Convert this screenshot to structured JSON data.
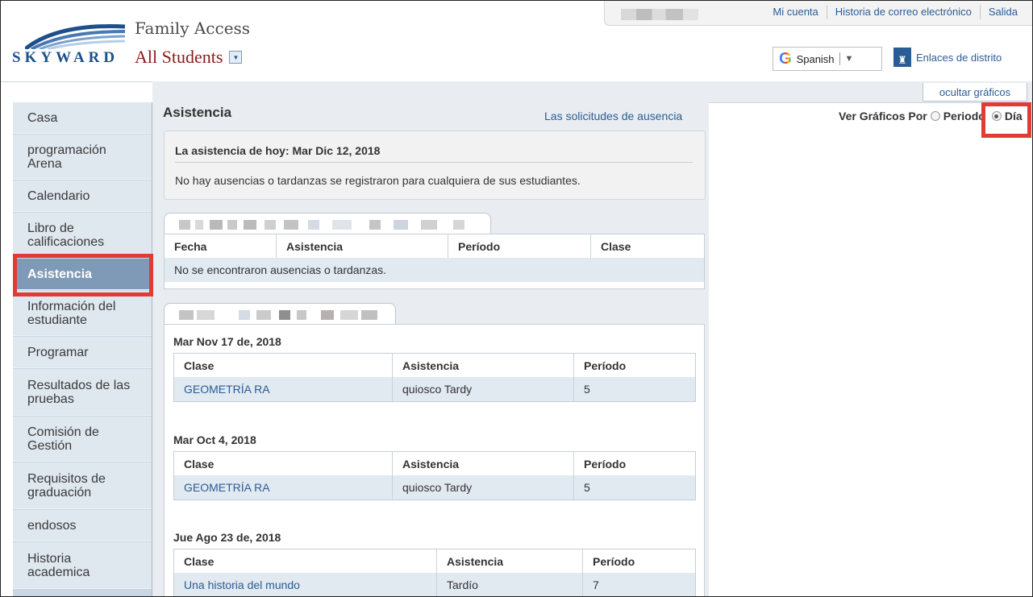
{
  "header": {
    "logo_text": "SKYWARD",
    "family_access": "Family Access",
    "student_selector": "All Students",
    "top_links": [
      "Mi cuenta",
      "Historia de correo electrónico",
      "Salida"
    ],
    "translate_language": "Spanish",
    "district_links": "Enlaces de distrito"
  },
  "sidebar": {
    "items": [
      {
        "label": "Casa"
      },
      {
        "label": "programación Arena"
      },
      {
        "label": "Calendario"
      },
      {
        "label": "Libro de calificaciones"
      },
      {
        "label": "Asistencia",
        "active": true
      },
      {
        "label": "Información del estudiante"
      },
      {
        "label": "Programar"
      },
      {
        "label": "Resultados de las pruebas"
      },
      {
        "label": "Comisión de Gestión"
      },
      {
        "label": "Requisitos de graduación"
      },
      {
        "label": "endosos"
      },
      {
        "label": "Historia academica"
      }
    ]
  },
  "main": {
    "title": "Asistencia",
    "absence_requests_link": "Las solicitudes de ausencia",
    "today": {
      "title": "La asistencia de hoy: Mar Dic 12, 2018",
      "message": "No hay ausencias o tardanzas se registraron para cualquiera de sus estudiantes."
    },
    "student1": {
      "headers": [
        "Fecha",
        "Asistencia",
        "Período",
        "Clase"
      ],
      "empty_message": "No se encontraron ausencias o tardanzas."
    },
    "student2": {
      "groups": [
        {
          "date": "Mar Nov 17 de, 2018",
          "headers": [
            "Clase",
            "Asistencia",
            "Período"
          ],
          "class": "GEOMETRÍA RA",
          "attendance": "quiosco Tardy",
          "period": "5"
        },
        {
          "date": "Mar Oct 4, 2018",
          "headers": [
            "Clase",
            "Asistencia",
            "Período"
          ],
          "class": "GEOMETRÍA RA",
          "attendance": "quiosco Tardy",
          "period": "5"
        },
        {
          "date": "Jue Ago 23 de, 2018",
          "headers": [
            "Clase",
            "Asistencia",
            "Período"
          ],
          "class": "Una historia del mundo",
          "attendance": "Tardío",
          "period": "7"
        }
      ]
    }
  },
  "charts": {
    "hide_charts": "ocultar gráficos",
    "view_by_label": "Ver Gráficos Por",
    "option_period": "Periodo",
    "option_day": "Día",
    "selected": "Día"
  },
  "colors": {
    "highlight": "#e03b34",
    "link": "#2a5c96",
    "sidebar_active": "#7f9ab6",
    "brand": "#1d4f8b"
  }
}
